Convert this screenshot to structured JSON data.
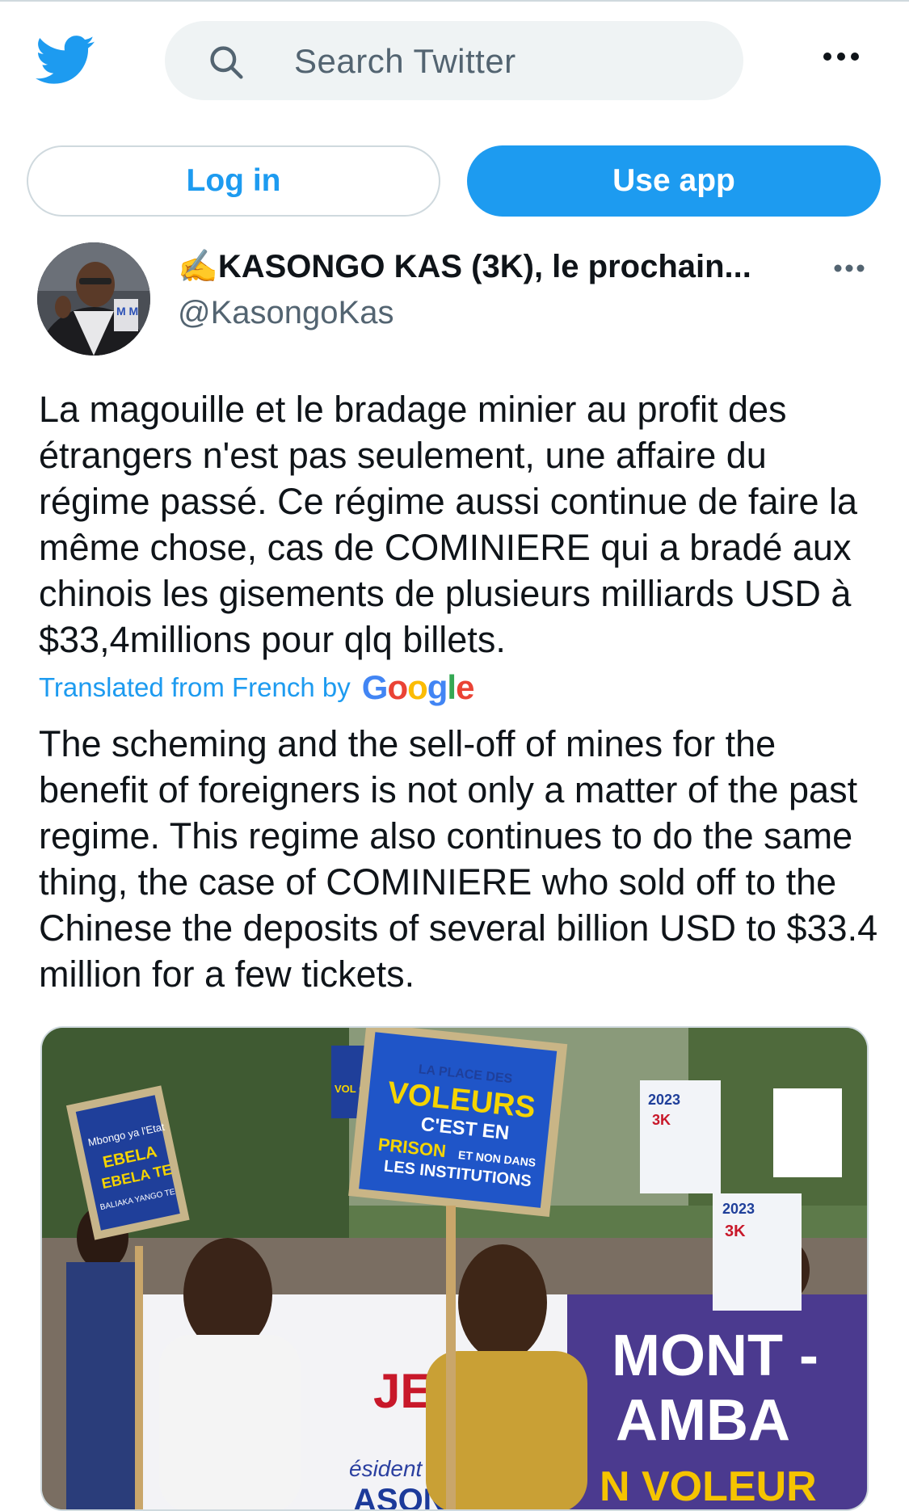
{
  "header": {
    "search_placeholder": "Search Twitter",
    "logo_icon": "twitter-bird-icon",
    "more_icon": "more-horizontal-icon"
  },
  "actions": {
    "login_label": "Log in",
    "use_app_label": "Use app"
  },
  "tweet": {
    "author_emoji": "✍️",
    "author_name": "KASONGO KAS (3K), le prochain...",
    "handle": "@KasongoKas",
    "text_original": "La magouille et le bradage minier au profit des étrangers n'est pas seulement, une affaire du régime passé. Ce régime aussi continue de faire la même chose, cas de COMINIERE qui a bradé aux chinois les gisements de plusieurs milliards USD à $33,4millions pour qlq billets.",
    "translated_label": "Translated from French by",
    "translation_provider": "Google",
    "text_translated": "The scheming and the sell-off of mines for the benefit of foreigners is not only a matter of the past regime. This regime also continues to do the same thing, the case of COMINIERE who sold off to the Chinese the deposits of several billion USD to $33.4 million for a few tickets.",
    "photo": {
      "sign_left_lines": [
        "Mbongo ya l'Etat",
        "EBELA",
        "EBELA TE",
        "BALIAKA YANGO TE"
      ],
      "sign_center_lines": [
        "LA PLACE DES",
        "VOLEURS",
        "C'EST EN",
        "PRISON",
        "ET NON DANS",
        "LES INSTITUTIONS"
      ],
      "poster_year": "2023",
      "poster_mark": "3K",
      "banner_left": "JE S",
      "banner_right_1": "MONT -",
      "banner_right_2": "AMBA",
      "banner_right_3": "N VOLEUR",
      "sign_small": "VOL C'ES PRIS NON",
      "banner_script": "ésident",
      "banner_name": "ASON"
    }
  },
  "colors": {
    "accent": "#1d9bf0",
    "secondary_text": "#536471",
    "search_bg": "#eff3f4"
  }
}
